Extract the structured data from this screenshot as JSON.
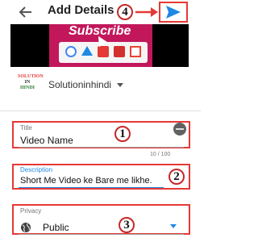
{
  "header": {
    "title": "Add Details",
    "back_icon": "arrow-left-icon",
    "send_icon": "send-icon",
    "accent": "#1e88e5"
  },
  "callouts": [
    "1",
    "2",
    "3",
    "4"
  ],
  "thumbnail": {
    "banner_text": "Subscribe"
  },
  "channel": {
    "logo_lines": [
      "SOLUTION",
      "IN",
      "HINDI"
    ],
    "name": "Solutioninhindi"
  },
  "form": {
    "title_label": "Title",
    "title_value": "Video Name",
    "title_counter": "10 / 100",
    "description_label": "Description",
    "description_value": "Short Me Video ke Bare me likhe.",
    "privacy_label": "Privacy",
    "privacy_value": "Public"
  },
  "colors": {
    "highlight": "#e53935",
    "thumbnail_accent": "#c2185b"
  }
}
